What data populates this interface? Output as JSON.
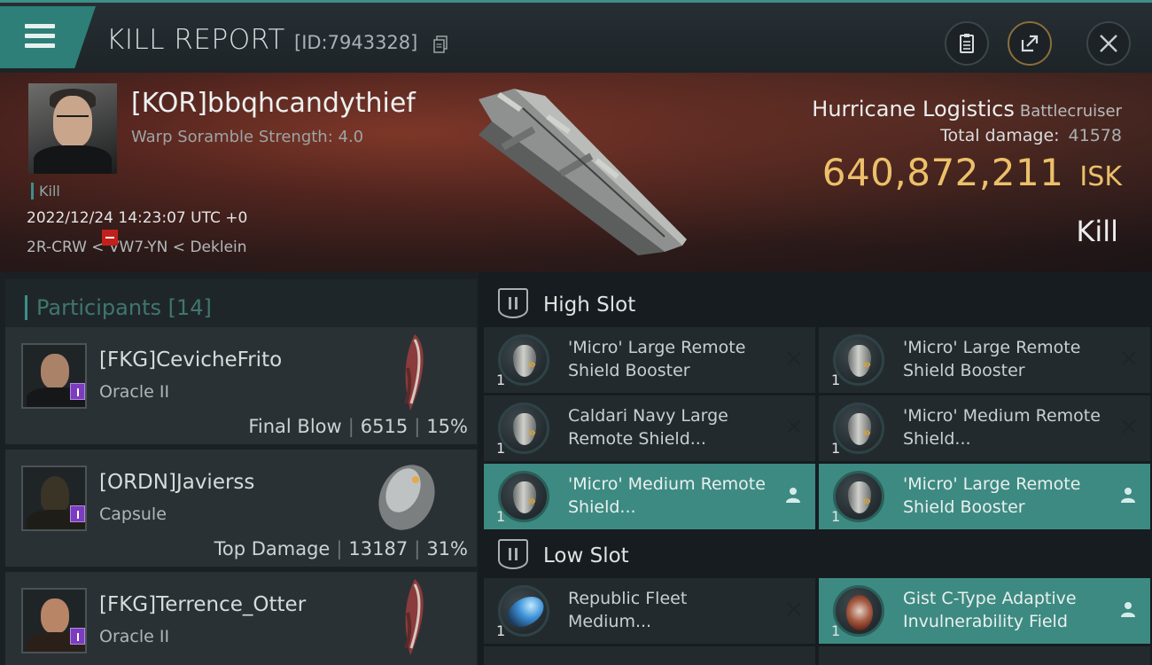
{
  "header": {
    "title": "KILL REPORT",
    "kill_id": "[ID:7943328]"
  },
  "victim": {
    "name": "[KOR]bbqhcandythief",
    "scramble": "Warp Soramble Strength: 4.0",
    "kill_tag": "Kill",
    "timestamp": "2022/12/24 14:23:07 UTC +0",
    "location": "2R-CRW < VW7-YN < Deklein",
    "ship_name": "Hurricane Logistics",
    "ship_class": "Battlecruiser",
    "damage_label": "Total damage:",
    "damage_value": "41578",
    "isk_value": "640,872,211",
    "isk_unit": "ISK",
    "result": "Kill"
  },
  "participants": {
    "title": "Participants",
    "count": "[14]",
    "items": [
      {
        "name": "[FKG]CevicheFrito",
        "ship": "Oracle II",
        "role": "Final Blow",
        "damage": "6515",
        "percent": "15%"
      },
      {
        "name": "[ORDN]Javierss",
        "ship": "Capsule",
        "role": "Top Damage",
        "damage": "13187",
        "percent": "31%"
      },
      {
        "name": "[FKG]Terrence_Otter",
        "ship": "Oracle II"
      }
    ]
  },
  "fitting": {
    "high_slot": {
      "title": "High Slot",
      "modules": [
        {
          "qty": "1",
          "name": "'Micro' Large Remote Shield Booster",
          "state": "destroyed",
          "icon": "shield-booster-icon"
        },
        {
          "qty": "1",
          "name": "'Micro' Large Remote Shield Booster",
          "state": "destroyed",
          "icon": "shield-booster-icon"
        },
        {
          "qty": "1",
          "name": "Caldari Navy Large Remote Shield...",
          "state": "destroyed",
          "icon": "shield-booster-icon"
        },
        {
          "qty": "1",
          "name": "'Micro' Medium Remote Shield...",
          "state": "destroyed",
          "icon": "shield-booster-icon"
        },
        {
          "qty": "1",
          "name": "'Micro' Medium Remote Shield...",
          "state": "dropped",
          "icon": "shield-booster-icon"
        },
        {
          "qty": "1",
          "name": "'Micro' Large Remote Shield Booster",
          "state": "dropped",
          "icon": "shield-booster-icon"
        }
      ]
    },
    "low_slot": {
      "title": "Low Slot",
      "modules": [
        {
          "qty": "1",
          "name": "Republic Fleet Medium...",
          "state": "destroyed",
          "icon": "plating-icon"
        },
        {
          "qty": "1",
          "name": "Gist C-Type Adaptive Invulnerability Field",
          "state": "dropped",
          "icon": "invulnerability-field-icon"
        }
      ]
    }
  },
  "colors": {
    "accent": "#3d8f87",
    "isk": "#ecc06a",
    "active_module": "#3d8a82",
    "corp_badge": "#7c3cbf"
  }
}
